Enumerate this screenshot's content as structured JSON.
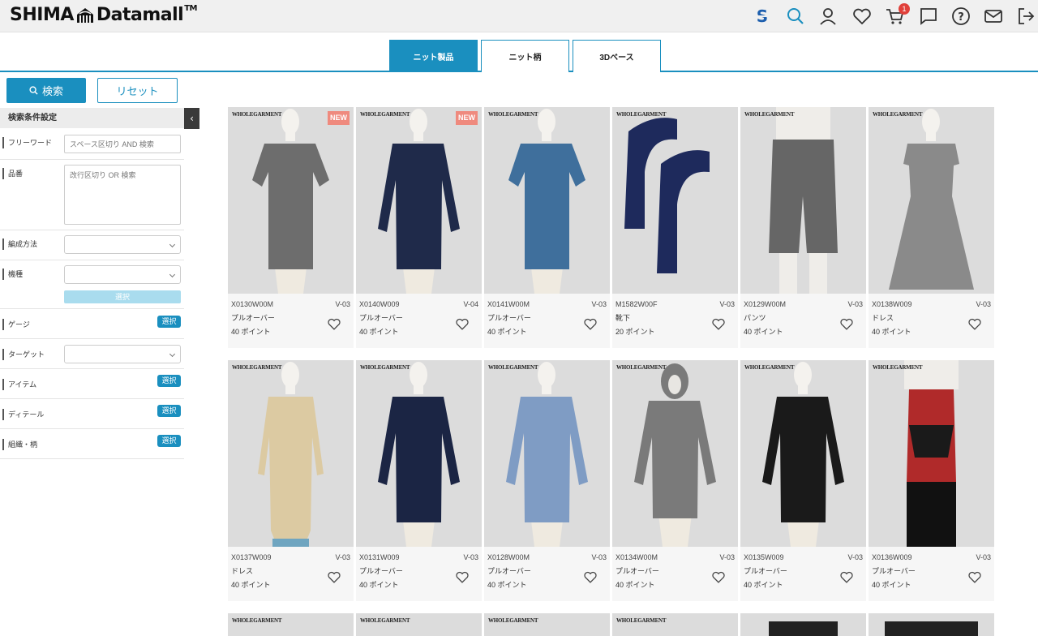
{
  "header": {
    "brand_left": "SHIMA",
    "brand_right": "Datamall",
    "brand_tm": "TM",
    "cart_count": "1"
  },
  "tabs": [
    {
      "label": "ニット製品",
      "active": true
    },
    {
      "label": "ニット柄",
      "active": false
    },
    {
      "label": "3Dベース",
      "active": false
    }
  ],
  "sidebar": {
    "search_label": "検索",
    "reset_label": "リセット",
    "conditions_title": "検索条件設定",
    "free_word_label": "フリーワード",
    "free_word_placeholder": "スペース区切り AND 検索",
    "item_no_label": "品番",
    "item_no_placeholder": "改行区切り OR 検索",
    "knit_method_label": "編成方法",
    "machine_label": "機種",
    "machine_select_label": "選択",
    "gauge_label": "ゲージ",
    "target_label": "ターゲット",
    "item_label": "アイテム",
    "detail_label": "ディテール",
    "structure_label": "組織・柄",
    "select_label": "選択"
  },
  "products": [
    {
      "code": "X0130W00M",
      "ver": "V-03",
      "name": "プルオーバー",
      "points": "40 ポイント",
      "maker": "WHOLEGARMENT",
      "is_new": true,
      "badge": "NEW",
      "color": "#6d6d6d"
    },
    {
      "code": "X0140W009",
      "ver": "V-04",
      "name": "プルオーバー",
      "points": "40 ポイント",
      "maker": "WHOLEGARMENT",
      "is_new": true,
      "badge": "NEW",
      "color": "#1f2a4a"
    },
    {
      "code": "X0141W00M",
      "ver": "V-03",
      "name": "プルオーバー",
      "points": "40 ポイント",
      "maker": "WHOLEGARMENT",
      "is_new": false,
      "color": "#3f6f9c"
    },
    {
      "code": "M1582W00F",
      "ver": "V-03",
      "name": "靴下",
      "points": "20 ポイント",
      "maker": "WHOLEGARMENT",
      "is_new": false,
      "color": "#1e2a5c"
    },
    {
      "code": "X0129W00M",
      "ver": "V-03",
      "name": "パンツ",
      "points": "40 ポイント",
      "maker": "WHOLEGARMENT",
      "is_new": false,
      "color": "#666666"
    },
    {
      "code": "X0138W009",
      "ver": "V-03",
      "name": "ドレス",
      "points": "40 ポイント",
      "maker": "WHOLEGARMENT",
      "is_new": false,
      "color": "#8a8a8a"
    },
    {
      "code": "X0137W009",
      "ver": "V-03",
      "name": "ドレス",
      "points": "40 ポイント",
      "maker": "WHOLEGARMENT",
      "is_new": false,
      "color": "#dccaa2"
    },
    {
      "code": "X0131W009",
      "ver": "V-03",
      "name": "プルオーバー",
      "points": "40 ポイント",
      "maker": "WHOLEGARMENT",
      "is_new": false,
      "color": "#1b2544"
    },
    {
      "code": "X0128W00M",
      "ver": "V-03",
      "name": "プルオーバー",
      "points": "40 ポイント",
      "maker": "WHOLEGARMENT",
      "is_new": false,
      "color": "#7f9cc4"
    },
    {
      "code": "X0134W00M",
      "ver": "V-03",
      "name": "プルオーバー",
      "points": "40 ポイント",
      "maker": "WHOLEGARMENT",
      "is_new": false,
      "color": "#7a7a7a"
    },
    {
      "code": "X0135W009",
      "ver": "V-03",
      "name": "プルオーバー",
      "points": "40 ポイント",
      "maker": "WHOLEGARMENT",
      "is_new": false,
      "color": "#1a1a1a"
    },
    {
      "code": "X0136W009",
      "ver": "V-03",
      "name": "プルオーバー",
      "points": "40 ポイント",
      "maker": "WHOLEGARMENT",
      "is_new": false,
      "color": "#b02a2a"
    }
  ],
  "next_row_makers": [
    "WHOLEGARMENT",
    "WHOLEGARMENT",
    "WHOLEGARMENT",
    "WHOLEGARMENT"
  ]
}
